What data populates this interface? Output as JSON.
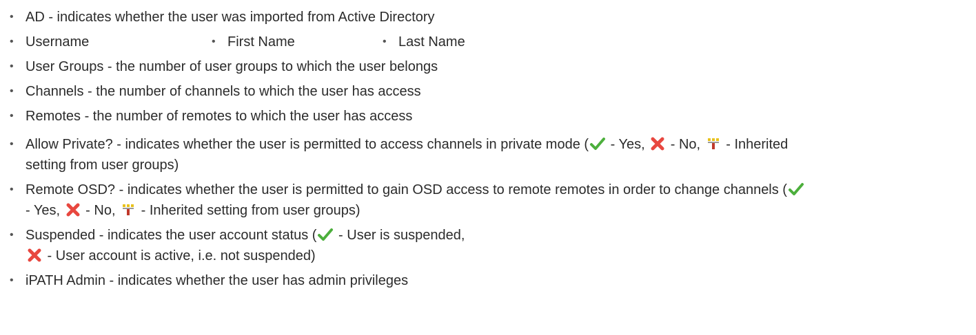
{
  "items": {
    "ad": "AD - indicates whether the user was imported from Active Directory",
    "username": "Username",
    "first_name": "First Name",
    "last_name": "Last Name",
    "user_groups": "User Groups - the number of user groups to which the user belongs",
    "channels": "Channels - the number of channels to which the user has access",
    "remotes": "Remotes - the number of remotes to which the user has access",
    "allow_private": {
      "prefix": "Allow Private? - indicates whether the user is permitted to access channels in private mode (",
      "yes": " - Yes, ",
      "no": " - No, ",
      "inherited_line1": " - Inherited",
      "inherited_line2": "setting from user groups)"
    },
    "remote_osd": {
      "prefix": "Remote OSD? - indicates whether the user is permitted to gain OSD access to remote remotes in order to change channels (",
      "yes": "- Yes, ",
      "no": " - No, ",
      "inherited": " - Inherited setting from user groups)"
    },
    "suspended": {
      "prefix": "Suspended - indicates the user account status (",
      "suspended_text": " - User is suspended,",
      "active_text": " - User account is active, i.e. not suspended)"
    },
    "ipath_admin": "iPATH Admin - indicates whether the user has admin privileges"
  },
  "icons": {
    "check": "check-icon",
    "cross": "cross-icon",
    "inherited": "inherited-icon"
  },
  "colors": {
    "text": "#2b2b2b",
    "check_green": "#4caf3c",
    "cross_red": "#e8473f",
    "inherited_yellow": "#e8c21c",
    "inherited_red": "#c0392b"
  }
}
